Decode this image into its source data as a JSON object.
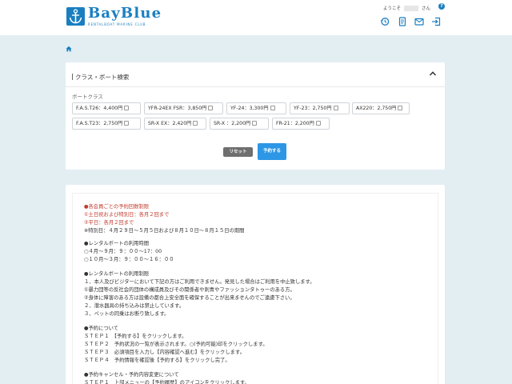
{
  "header": {
    "logo_text": "BayBlue",
    "logo_sub": "RENTALBOAT MARINE CLUB",
    "welcome_prefix": "ようこそ",
    "welcome_suffix": "さん",
    "brand_color": "#1a7fc0"
  },
  "search": {
    "title": "クラス・ボート検索",
    "boat_class_label": "ボートクラス",
    "boats": [
      {
        "label": "F.A.S.T26：4,400円"
      },
      {
        "label": "YFR-24EX FSR：3,850円"
      },
      {
        "label": "YF-24：3,300円"
      },
      {
        "label": "YF-23：2,750円"
      },
      {
        "label": "AX220：2,750円"
      },
      {
        "label": "F.A.S.T23：2,750円"
      },
      {
        "label": "SR-X EX：2,420円"
      },
      {
        "label": "SR-X ：2,200円"
      },
      {
        "label": "FR-21：2,200円"
      }
    ],
    "reset_label": "リセット",
    "reserve_label": "予約する"
  },
  "notice": {
    "lines": [
      {
        "text": "●各会員ごとの予約回数制限",
        "red": true
      },
      {
        "text": "①土日祝および特別日：各月２回まで",
        "red": true
      },
      {
        "text": "②平日：各月２回まで",
        "red": true
      },
      {
        "text": "※特別日：４月２９日～５月５日および８月１０日～８月１５日の期間",
        "red": false
      },
      {
        "text": "●レンタルボートの利用時間",
        "red": false
      },
      {
        "text": "○４月～９月：９：００～17：00",
        "red": false
      },
      {
        "text": "○１０月～３月：９：００～１６：００",
        "red": false
      },
      {
        "text": "●レンタルボートの利用制限",
        "red": false
      },
      {
        "text": "１、本人及びビジターにおいて下記の方はご利用できません。発見した場合はご利用を中止致します。",
        "red": false
      },
      {
        "text": "①暴力団等の反社会的団体の構成員及びその関係者や刺青やファッションタトゥーのある方。",
        "red": false
      },
      {
        "text": "②身体に障害のある方は設備の都合上安全面を確保することが出来ませんのでご遠慮下さい。",
        "red": false
      },
      {
        "text": "２、潜水器具の持ち込みは禁止しています。",
        "red": false
      },
      {
        "text": "３、ペットの同乗はお断り致します。",
        "red": false
      },
      {
        "text": "●予約について",
        "red": false
      },
      {
        "text": "ＳＴＥＰ１　【予約する】をクリックします。",
        "red": false
      },
      {
        "text": "ＳＴＥＰ２　予約状況の一覧が表示されます。○(予約可能)印をクリックします。",
        "red": false
      },
      {
        "text": "ＳＴＥＰ３　必須項目を入力し【内容確認へ進む】をクリックします。",
        "red": false
      },
      {
        "text": "ＳＴＥＰ４　予約情報を確認後【予約する】をクリックし完了。",
        "red": false
      },
      {
        "text": "●予約キャンセル・予約内容変更について",
        "red": false
      },
      {
        "text": "ＳＴＥＰ１　上部メニューの【予約履歴】のアイコンをクリックします。",
        "red": false
      }
    ]
  }
}
